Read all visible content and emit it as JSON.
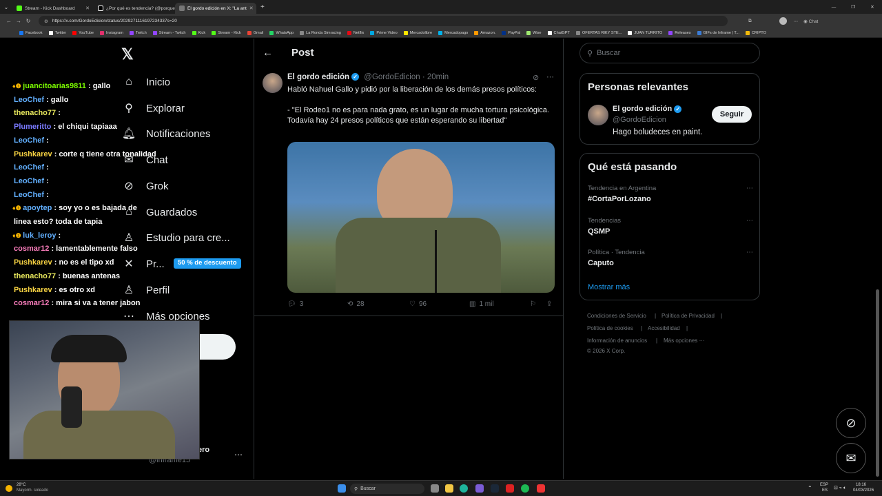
{
  "browser": {
    "tabs": [
      {
        "title": "Stream - Kick Dashboard",
        "color": "#53fc18"
      },
      {
        "title": "¿Por qué es tendencia? (@porque",
        "color": "#ffffff"
      },
      {
        "title": "El gordo edición en X: \"La ant",
        "color": "#ffffff"
      }
    ],
    "url": "https://x.com/GordoEdicion/status/2029271116197234337s=20",
    "bookmarks": [
      {
        "label": "Facebook",
        "color": "#1877f2"
      },
      {
        "label": "Twitter",
        "color": "#ffffff"
      },
      {
        "label": "YouTube",
        "color": "#ff0000"
      },
      {
        "label": "Instagram",
        "color": "#e1306c"
      },
      {
        "label": "Twitch",
        "color": "#9146ff"
      },
      {
        "label": "Stream - Twitch",
        "color": "#9146ff"
      },
      {
        "label": "Kick",
        "color": "#53fc18"
      },
      {
        "label": "Stream - Kick",
        "color": "#53fc18"
      },
      {
        "label": "Gmail",
        "color": "#ea4335"
      },
      {
        "label": "WhatsApp",
        "color": "#25d366"
      },
      {
        "label": "La Ronda Simracing",
        "color": "#888888"
      },
      {
        "label": "Netflix",
        "color": "#e50914"
      },
      {
        "label": "Prime Video",
        "color": "#00a8e1"
      },
      {
        "label": "Mercadolibre",
        "color": "#ffe600"
      },
      {
        "label": "Mercadopago",
        "color": "#00b1ea"
      },
      {
        "label": "Amazon.",
        "color": "#ff9900"
      },
      {
        "label": "PayPal",
        "color": "#003087"
      },
      {
        "label": "Wise",
        "color": "#9fe870"
      },
      {
        "label": "ChatGPT",
        "color": "#ffffff"
      },
      {
        "label": "OFERTAS RIKY STE...",
        "color": "#888888"
      },
      {
        "label": "JUAN TURRITO",
        "color": "#ffffff"
      },
      {
        "label": "Releases",
        "color": "#9146ff"
      },
      {
        "label": "GIFs de Inframe | T...",
        "color": "#3a7bd5"
      },
      {
        "label": "CRIPTO",
        "color": "#f0b90b"
      }
    ]
  },
  "nav": {
    "items": [
      {
        "label": "Inicio",
        "icon": "⌂"
      },
      {
        "label": "Explorar",
        "icon": "⚲"
      },
      {
        "label": "Notificaciones",
        "icon": "🔔︎"
      },
      {
        "label": "Chat",
        "icon": "✉"
      },
      {
        "label": "Grok",
        "icon": "⊘"
      },
      {
        "label": "Guardados",
        "icon": "⌂"
      },
      {
        "label": "Estudio para cre...",
        "icon": "♙"
      },
      {
        "label": "Pr...",
        "icon": "✕"
      },
      {
        "label": "Perfil",
        "icon": "♙"
      },
      {
        "label": "Más opciones",
        "icon": "⋯"
      }
    ],
    "promo": "50 % de descuento",
    "user_partial": "ero",
    "handle_partial": "@inframe15"
  },
  "chat": [
    {
      "user": "juancitoarias9811",
      "msg": ": gallo",
      "color": "#7cfc00",
      "badge": true
    },
    {
      "user": "LeoChef",
      "msg": ": gallo",
      "color": "#62b0ff",
      "badge": false
    },
    {
      "user": "thenacho77",
      "msg": ":",
      "color": "#e6e65c",
      "badge": false
    },
    {
      "user": "Plumeritto",
      "msg": ": el chiqui tapiaaa",
      "color": "#7a7aff",
      "badge": false
    },
    {
      "user": "LeoChef",
      "msg": ":",
      "color": "#62b0ff",
      "badge": false
    },
    {
      "user": "Pushkarev",
      "msg": ": corte q tiene otra tonalidad",
      "color": "#f5d142",
      "badge": false
    },
    {
      "user": "LeoChef",
      "msg": ":",
      "color": "#62b0ff",
      "badge": false
    },
    {
      "user": "LeoChef",
      "msg": ":",
      "color": "#62b0ff",
      "badge": false
    },
    {
      "user": "LeoChef",
      "msg": ":",
      "color": "#62b0ff",
      "badge": false
    },
    {
      "user": "apoytep",
      "msg": ": soy yo o es bajada de",
      "color": "#62b0ff",
      "badge": true
    },
    {
      "user": "",
      "msg": "linea esto? toda de tapia",
      "color": "#ffffff",
      "badge": false
    },
    {
      "user": "luk_leroy",
      "msg": ":",
      "color": "#62b0ff",
      "badge": true
    },
    {
      "user": "cosmar12",
      "msg": ": lamentablemente falso",
      "color": "#ff7fbf",
      "badge": false
    },
    {
      "user": "Pushkarev",
      "msg": ": no es el tipo xd",
      "color": "#f5d142",
      "badge": false
    },
    {
      "user": "thenacho77",
      "msg": ": buenas antenas",
      "color": "#e6e65c",
      "badge": false
    },
    {
      "user": "Pushkarev",
      "msg": ": es otro xd",
      "color": "#f5d142",
      "badge": false
    },
    {
      "user": "cosmar12",
      "msg": ": mira si va a tener jabon",
      "color": "#ff7fbf",
      "badge": false
    }
  ],
  "post": {
    "header": "Post",
    "author": "El gordo edición",
    "handle": "@GordoEdicion · 20min",
    "text": "Habló Nahuel Gallo y pidió por la liberación de los demás presos políticos:\n\n- \"El Rodeo1 no es para nada grato, es un lugar de mucha tortura psicológica. Todavía hay 24 presos políticos que están esperando su libertad\"",
    "replies": "3",
    "reposts": "28",
    "likes": "96",
    "views": "1 mil"
  },
  "right": {
    "search_placeholder": "Buscar",
    "relevant_title": "Personas relevantes",
    "person_name": "El gordo edición",
    "person_handle": "@GordoEdicion",
    "person_bio": "Hago boludeces en paint.",
    "follow_label": "Seguir",
    "trends_title": "Qué está pasando",
    "trends": [
      {
        "category": "Tendencia en Argentina",
        "name": "#CortaPorLozano"
      },
      {
        "category": "Tendencias",
        "name": "QSMP"
      },
      {
        "category": "Política · Tendencia",
        "name": "Caputo"
      }
    ],
    "show_more": "Mostrar más",
    "footer": {
      "terms": "Condiciones de Servicio",
      "privacy": "Política de Privacidad",
      "cookies": "Política de cookies",
      "accessibility": "Accesibilidad",
      "ads": "Información de anuncios",
      "more": "Más opciones ···",
      "copyright": "© 2026 X Corp."
    }
  },
  "taskbar": {
    "weather_temp": "28°C",
    "weather_desc": "Mayorm. soleado",
    "search": "Buscar",
    "lang1": "ESP",
    "lang2": "ES",
    "time": "18:16",
    "date": "04/03/2026"
  }
}
